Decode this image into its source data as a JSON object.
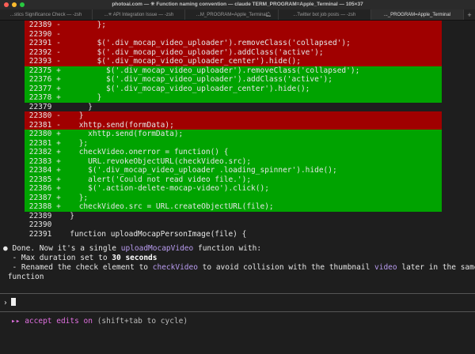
{
  "window": {
    "title": "photoai.com — ✳ Function naming convention — claude TERM_PROGRAM=Apple_Terminal — 105×37",
    "traffic_colors": [
      "#ff5f57",
      "#febc2e",
      "#28c840"
    ]
  },
  "tabs": [
    {
      "label": "...stics Significance Check — -zsh"
    },
    {
      "label": "...✳ API Integration Issue — -zsh"
    },
    {
      "label": "...M_PROGRAM=Apple_Terminal",
      "bell": true
    },
    {
      "label": "...Twitter bot job posts — -zsh"
    },
    {
      "label": "..._PROGRAM=Apple_Terminal",
      "active": true
    }
  ],
  "diff": [
    {
      "type": "del",
      "num": "22389",
      "sign": "-",
      "code": "       };"
    },
    {
      "type": "del",
      "num": "22390",
      "sign": "-",
      "code": ""
    },
    {
      "type": "del",
      "num": "22391",
      "sign": "-",
      "code": "       $('.div_mocap_video_uploader').removeClass('collapsed');"
    },
    {
      "type": "del",
      "num": "22392",
      "sign": "-",
      "code": "       $('.div_mocap_video_uploader').addClass('active');"
    },
    {
      "type": "del",
      "num": "22393",
      "sign": "-",
      "code": "       $('.div_mocap_video_uploader_center').hide();"
    },
    {
      "type": "add",
      "num": "22375",
      "sign": "+",
      "code": "         $('.div_mocap_video_uploader').removeClass('collapsed');"
    },
    {
      "type": "add",
      "num": "22376",
      "sign": "+",
      "code": "         $('.div_mocap_video_uploader').addClass('active');"
    },
    {
      "type": "add",
      "num": "22377",
      "sign": "+",
      "code": "         $('.div_mocap_video_uploader_center').hide();"
    },
    {
      "type": "add",
      "num": "22378",
      "sign": "+",
      "code": "       }"
    },
    {
      "type": "ctx",
      "num": "22379",
      "sign": " ",
      "code": "     }"
    },
    {
      "type": "del",
      "num": "22380",
      "sign": "-",
      "code": "   }"
    },
    {
      "type": "del",
      "num": "22381",
      "sign": "-",
      "code": "   xhttp.send(formData);"
    },
    {
      "type": "add",
      "num": "22380",
      "sign": "+",
      "code": "     xhttp.send(formData);"
    },
    {
      "type": "add",
      "num": "22381",
      "sign": "+",
      "code": "   };"
    },
    {
      "type": "add",
      "num": "22382",
      "sign": "+",
      "code": "   checkVideo.onerror = function() {"
    },
    {
      "type": "add",
      "num": "22383",
      "sign": "+",
      "code": "     URL.revokeObjectURL(checkVideo.src);"
    },
    {
      "type": "add",
      "num": "22384",
      "sign": "+",
      "code": "     $('.div_mocap_video_uploader .loading_spinner').hide();"
    },
    {
      "type": "add",
      "num": "22385",
      "sign": "+",
      "code": "     alert('Could not read video file.');"
    },
    {
      "type": "add",
      "num": "22386",
      "sign": "+",
      "code": "     $('.action-delete-mocap-video').click();"
    },
    {
      "type": "add",
      "num": "22387",
      "sign": "+",
      "code": "   };"
    },
    {
      "type": "add",
      "num": "22388",
      "sign": "+",
      "code": "   checkVideo.src = URL.createObjectURL(file);"
    },
    {
      "type": "ctx",
      "num": "22389",
      "sign": " ",
      "code": " }"
    },
    {
      "type": "ctx",
      "num": "22390",
      "sign": " ",
      "code": ""
    },
    {
      "type": "ctx",
      "num": "22391",
      "sign": " ",
      "code": " function uploadMocapPersonImage(file) {"
    }
  ],
  "message": {
    "bullet": "●",
    "l1_a": " Done. Now it's a single ",
    "l1_hl": "uploadMocapVideo",
    "l1_b": " function with:",
    "l2_a": "  - Max duration set to ",
    "l2_bold": "30 seconds",
    "l3_a": "  - Renamed the check element to ",
    "l3_hl1": "checkVideo",
    "l3_b": " to avoid collision with the thumbnail ",
    "l3_hl2": "video",
    "l3_c": " later in the same",
    "l4": " function"
  },
  "prompt": {
    "symbol": "›",
    "value": ""
  },
  "status": {
    "icon": "▸▸",
    "mode": "accept edits on",
    "hint": " (shift+tab to cycle)"
  }
}
